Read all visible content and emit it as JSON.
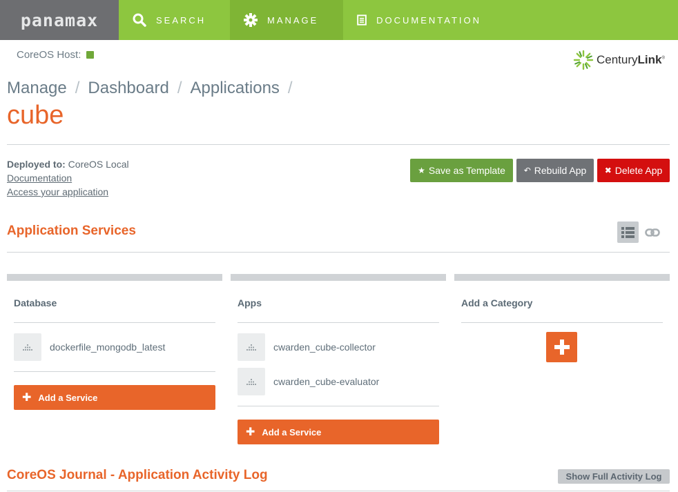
{
  "nav": {
    "logo": "panamax",
    "items": [
      {
        "label": "SEARCH",
        "icon": "search-icon"
      },
      {
        "label": "MANAGE",
        "icon": "gear-icon"
      },
      {
        "label": "DOCUMENTATION",
        "icon": "document-icon"
      }
    ]
  },
  "host": {
    "label": "CoreOS Host:",
    "status_color": "#70a839"
  },
  "brand": {
    "name_light": "Century",
    "name_bold": "Link",
    "mark": "®"
  },
  "breadcrumb": [
    "Manage",
    "Dashboard",
    "Applications"
  ],
  "breadcrumb_sep": "/",
  "app": {
    "title": "cube",
    "deployed_label": "Deployed to:",
    "deployed_value": "CoreOS Local",
    "doc_link": "Documentation",
    "access_link": "Access your application"
  },
  "actions": {
    "save": "Save as Template",
    "rebuild": "Rebuild App",
    "delete": "Delete App"
  },
  "services": {
    "title": "Application Services",
    "categories": [
      {
        "name": "Database",
        "services": [
          "dockerfile_mongodb_latest"
        ],
        "add_label": "Add a Service"
      },
      {
        "name": "Apps",
        "services": [
          "cwarden_cube-collector",
          "cwarden_cube-evaluator"
        ],
        "add_label": "Add a Service"
      }
    ],
    "add_category_label": "Add a Category"
  },
  "journal": {
    "title": "CoreOS Journal - Application Activity Log",
    "show_full": "Show Full Activity Log"
  },
  "colors": {
    "accent": "#e8652a",
    "nav": "#8dc63f",
    "save": "#6aa03f",
    "delete": "#d40f0f"
  }
}
